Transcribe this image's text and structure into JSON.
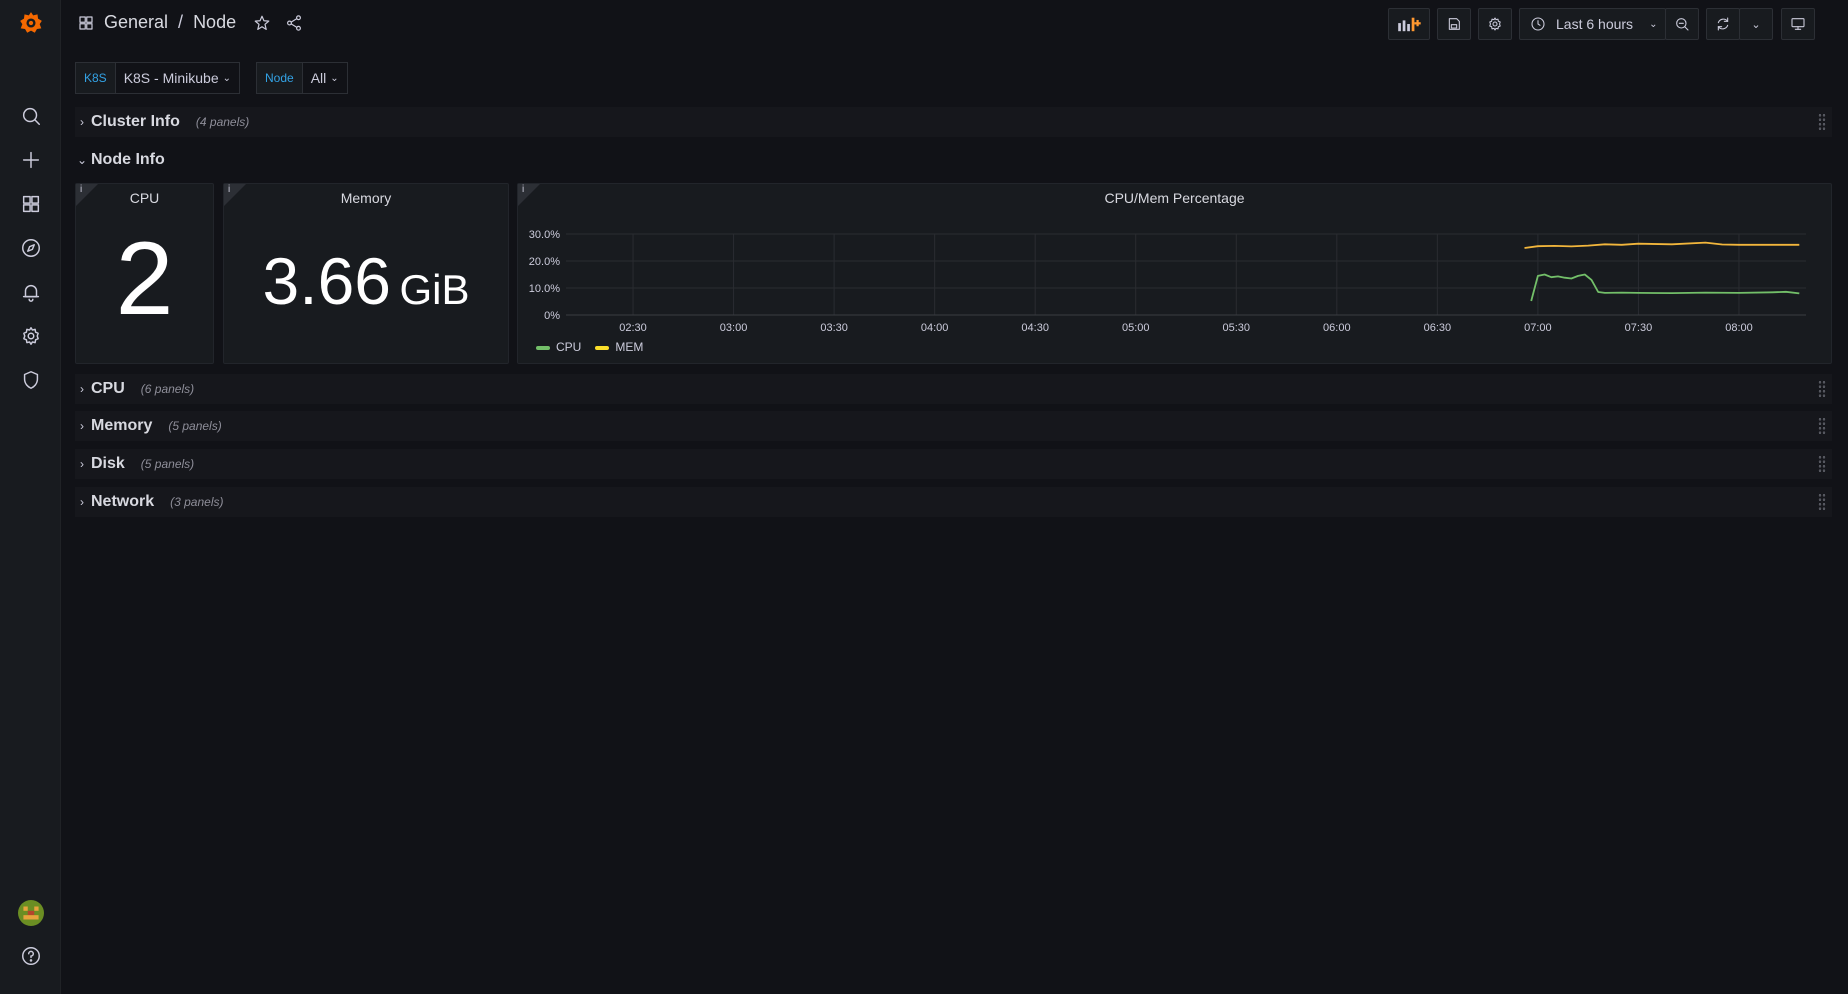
{
  "breadcrumb": {
    "folder": "General",
    "separator": "/",
    "dashboard": "Node"
  },
  "toolbar": {
    "time_range": "Last 6 hours"
  },
  "variables": [
    {
      "label": "K8S",
      "value": "K8S - Minikube"
    },
    {
      "label": "Node",
      "value": "All"
    }
  ],
  "rows": {
    "cluster": {
      "title": "Cluster Info",
      "count": "(4 panels)"
    },
    "node": {
      "title": "Node Info"
    },
    "cpu": {
      "title": "CPU",
      "count": "(6 panels)"
    },
    "memory": {
      "title": "Memory",
      "count": "(5 panels)"
    },
    "disk": {
      "title": "Disk",
      "count": "(5 panels)"
    },
    "network": {
      "title": "Network",
      "count": "(3 panels)"
    }
  },
  "panels": {
    "cpu": {
      "title": "CPU",
      "value": "2",
      "info": "i"
    },
    "memory": {
      "title": "Memory",
      "value": "3.66",
      "unit": "GiB",
      "info": "i"
    },
    "chart": {
      "title": "CPU/Mem Percentage",
      "info": "i"
    }
  },
  "colors": {
    "cpu": "#73bf69",
    "mem": "#fade2a",
    "memline": "#f2b63c",
    "accent": "#33a2e5"
  },
  "chart_data": {
    "type": "line",
    "title": "CPU/Mem Percentage",
    "y_ticks": [
      "0%",
      "10.0%",
      "20.0%",
      "30.0%"
    ],
    "ylim": [
      0,
      30
    ],
    "x_ticks": [
      "02:30",
      "03:00",
      "03:30",
      "04:00",
      "04:30",
      "05:00",
      "05:30",
      "06:00",
      "06:30",
      "07:00",
      "07:30",
      "08:00"
    ],
    "x_range": [
      "02:10",
      "08:20"
    ],
    "grid": true,
    "legend": "bottom-left",
    "series": [
      {
        "name": "CPU",
        "x": [
          "06:58",
          "07:00",
          "07:02",
          "07:04",
          "07:06",
          "07:08",
          "07:10",
          "07:12",
          "07:14",
          "07:16",
          "07:18",
          "07:20",
          "07:25",
          "07:30",
          "07:40",
          "07:50",
          "08:00",
          "08:10",
          "08:14",
          "08:18"
        ],
        "values": [
          5.2,
          14.5,
          15.0,
          14.0,
          14.3,
          13.8,
          13.5,
          14.5,
          15.0,
          13.0,
          8.5,
          8.2,
          8.3,
          8.2,
          8.1,
          8.3,
          8.2,
          8.4,
          8.6,
          8.0
        ]
      },
      {
        "name": "MEM",
        "x": [
          "06:56",
          "07:00",
          "07:05",
          "07:10",
          "07:15",
          "07:20",
          "07:25",
          "07:30",
          "07:40",
          "07:50",
          "07:55",
          "08:00",
          "08:10",
          "08:18"
        ],
        "values": [
          24.8,
          25.5,
          25.6,
          25.4,
          25.7,
          26.2,
          26.0,
          26.4,
          26.2,
          26.8,
          26.1,
          26.0,
          26.0,
          26.0
        ]
      }
    ]
  },
  "icons": [
    "grafana-logo-icon",
    "search-icon",
    "plus-icon",
    "dashboards-icon",
    "explore-icon",
    "alert-bell-icon",
    "gear-icon",
    "shield-icon",
    "avatar",
    "help-icon"
  ]
}
